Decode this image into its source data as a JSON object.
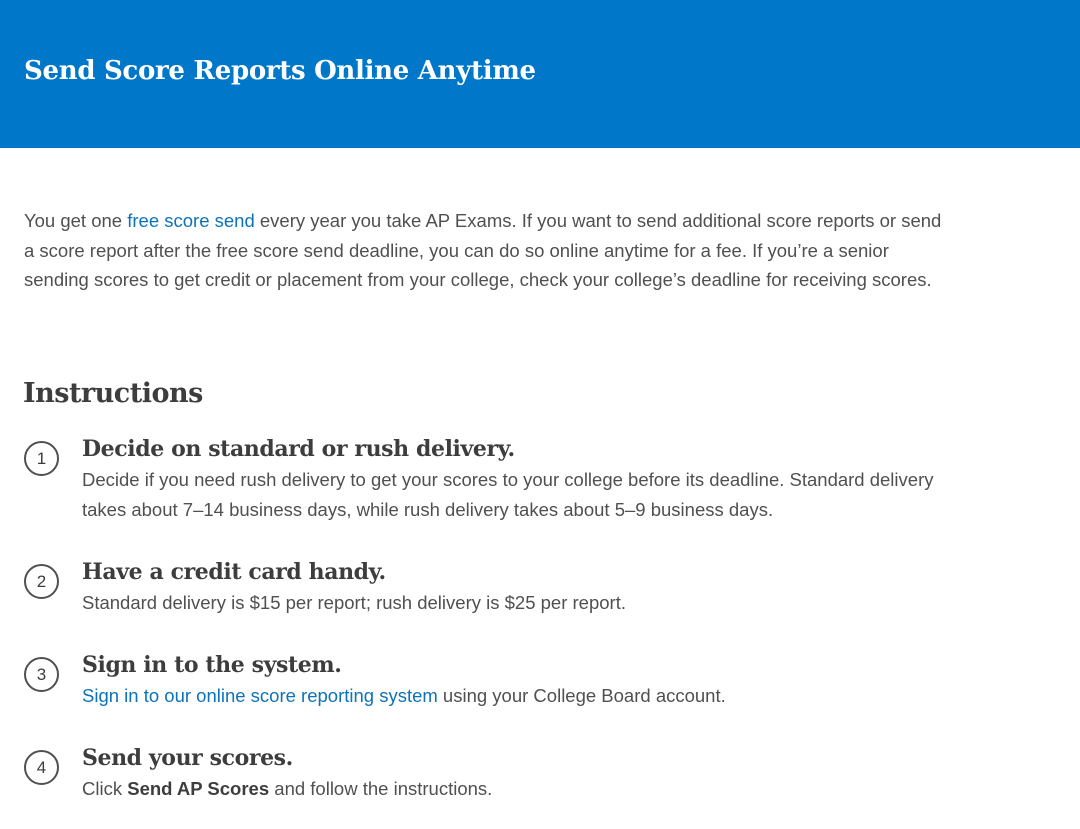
{
  "banner": {
    "title": "Send Score Reports Online Anytime"
  },
  "intro": {
    "before_link": "You get one ",
    "link_text": "free score send",
    "after_link": " every year you take AP Exams. If you want to send additional score reports or send a score report after the free score send deadline, you can do so online anytime for a fee. If you’re a senior sending scores to get credit or placement from your college, check your college’s deadline for receiving scores."
  },
  "instructions": {
    "heading": "Instructions",
    "steps": [
      {
        "number": "1",
        "title": "Decide on standard or rush delivery.",
        "description": "Decide if you need rush delivery to get your scores to your college before its deadline. Standard delivery takes about 7–14 business days, while rush delivery takes about 5–9 business days."
      },
      {
        "number": "2",
        "title": "Have a credit card handy.",
        "description": "Standard delivery is $15 per report; rush delivery is $25 per report."
      },
      {
        "number": "3",
        "title": "Sign in to the system.",
        "link_text": "Sign in to our online score reporting system",
        "after_link": " using your College Board account."
      },
      {
        "number": "4",
        "title": "Send your scores.",
        "before_bold": "Click ",
        "bold_text": "Send AP Scores",
        "after_bold": " and follow the instructions."
      }
    ]
  },
  "colors": {
    "banner_bg": "#0077c8",
    "link": "#0d73b9",
    "body_text": "#505050",
    "heading_text": "#3d3d3d"
  }
}
